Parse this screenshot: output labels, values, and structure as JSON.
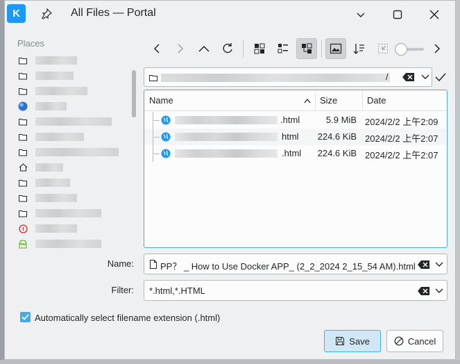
{
  "window": {
    "title": "All Files — Portal"
  },
  "places": {
    "title": "Places",
    "items": [
      {
        "icon": "folder-icon"
      },
      {
        "icon": "folder-icon"
      },
      {
        "icon": "folder-icon"
      },
      {
        "icon": "network-globe-icon"
      },
      {
        "icon": "folder-icon"
      },
      {
        "icon": "folder-icon"
      },
      {
        "icon": "folder-icon"
      },
      {
        "icon": "home-icon"
      },
      {
        "icon": "folder-icon"
      },
      {
        "icon": "folder-icon"
      },
      {
        "icon": "folder-icon"
      },
      {
        "icon": "debian-icon"
      },
      {
        "icon": "android-icon"
      }
    ]
  },
  "location": {
    "trailing": "/"
  },
  "table": {
    "columns": [
      "Name",
      "Size",
      "Date"
    ],
    "rows": [
      {
        "ext": ".html",
        "size": "5.9 MiB",
        "date": "2024/2/2 上午2:09"
      },
      {
        "ext": "html",
        "size": "224.6 KiB",
        "date": "2024/2/2 上午2:07"
      },
      {
        "ext": ".html",
        "size": "224.6 KiB",
        "date": "2024/2/2 上午2:07"
      }
    ]
  },
  "form": {
    "name_label": "Name:",
    "name_value": "PP？ _ How to Use Docker APP_ (2_2_2024 2_15_54 AM).html",
    "filter_label": "Filter:",
    "filter_value": "*.html,*.HTML",
    "auto_ext_label": "Automatically select filename extension (.html)",
    "auto_ext_checked": true
  },
  "buttons": {
    "save": "Save",
    "cancel": "Cancel"
  },
  "colors": {
    "accent": "#3daee9",
    "window_bg": "#eff0f1"
  }
}
